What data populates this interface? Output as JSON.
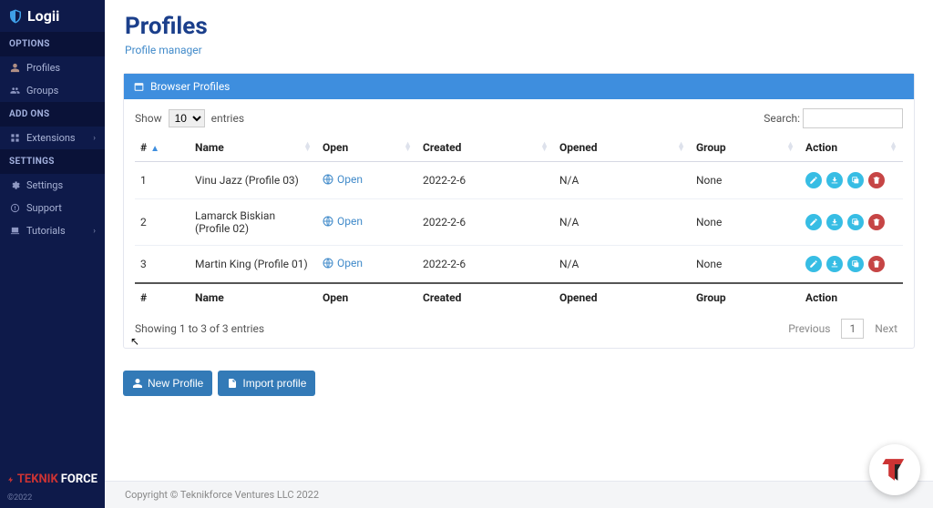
{
  "brand": "Logii",
  "sidebar": {
    "section_options": "OPTIONS",
    "section_addons": "ADD ONS",
    "section_settings": "SETTINGS",
    "items": {
      "profiles": "Profiles",
      "groups": "Groups",
      "extensions": "Extensions",
      "settings": "Settings",
      "support": "Support",
      "tutorials": "Tutorials"
    },
    "teknikforce_1": "TEKNIK",
    "teknikforce_2": "FORCE",
    "copyright_small": "©2022"
  },
  "page": {
    "title": "Profiles",
    "subtitle": "Profile manager"
  },
  "panel": {
    "title": "Browser Profiles"
  },
  "table": {
    "show_label_pre": "Show",
    "show_value": "10",
    "show_label_post": "entries",
    "search_label": "Search:",
    "headers": {
      "num": "#",
      "name": "Name",
      "open": "Open",
      "created": "Created",
      "opened": "Opened",
      "group": "Group",
      "action": "Action"
    },
    "rows": [
      {
        "num": "1",
        "name": "Vinu Jazz (Profile 03)",
        "open": "Open",
        "created": "2022-2-6",
        "opened": "N/A",
        "group": "None"
      },
      {
        "num": "2",
        "name": "Lamarck Biskian (Profile 02)",
        "open": "Open",
        "created": "2022-2-6",
        "opened": "N/A",
        "group": "None"
      },
      {
        "num": "3",
        "name": "Martin King (Profile 01)",
        "open": "Open",
        "created": "2022-2-6",
        "opened": "N/A",
        "group": "None"
      }
    ],
    "info": "Showing 1 to 3 of 3 entries",
    "prev": "Previous",
    "page_current": "1",
    "next": "Next"
  },
  "buttons": {
    "new_profile": "New Profile",
    "import_profile": "Import profile"
  },
  "footer": "Copyright © Teknikforce Ventures LLC 2022",
  "colors": {
    "accent": "#3e8ede",
    "sidebar": "#0e1a4a"
  }
}
